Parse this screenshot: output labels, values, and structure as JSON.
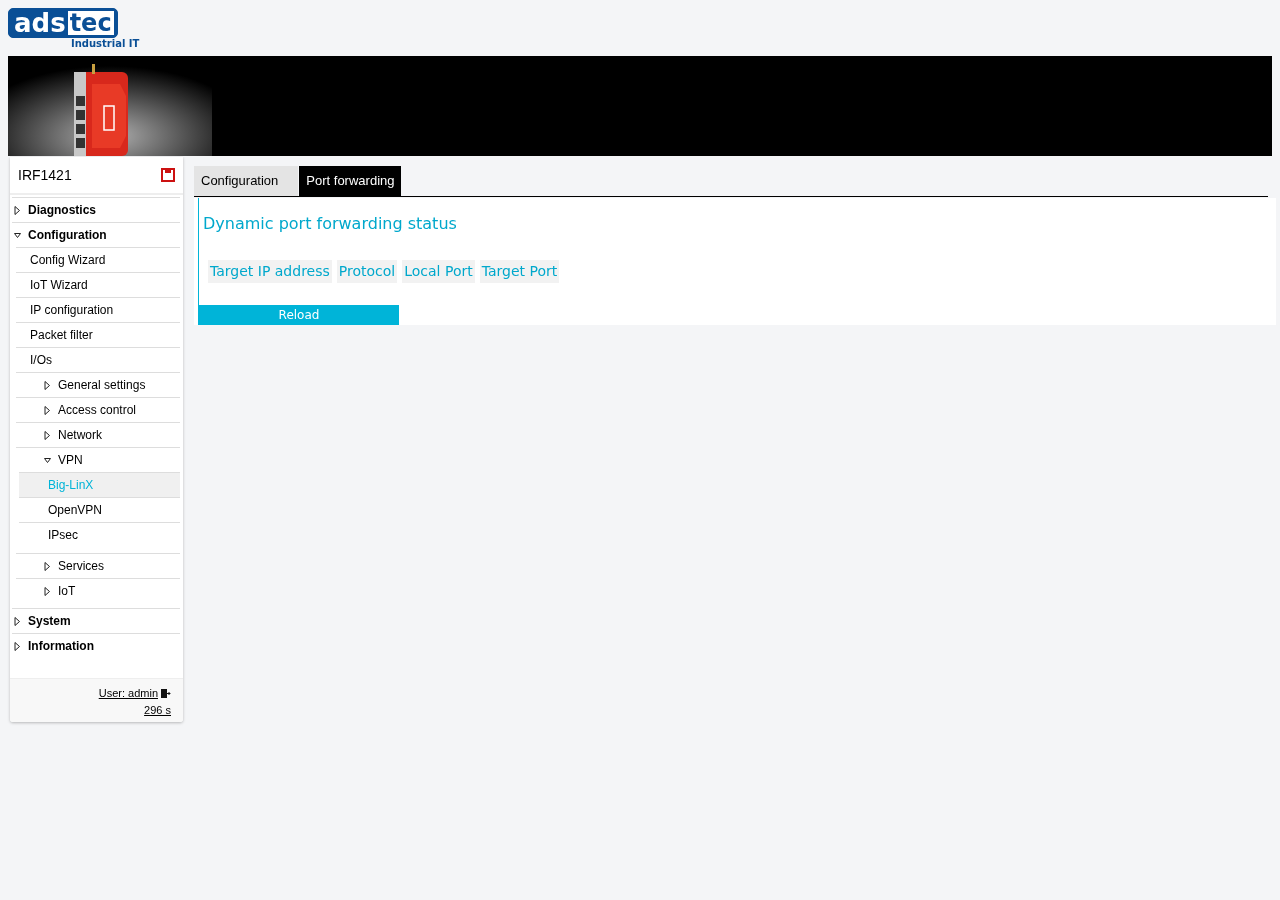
{
  "logo": {
    "left": "ads",
    "right": "tec",
    "tagline": "Industrial IT"
  },
  "sidebar": {
    "device": "IRF1421",
    "items": [
      {
        "label": "Diagnostics",
        "expanded": false
      },
      {
        "label": "Configuration",
        "expanded": true,
        "children": [
          {
            "label": "Config Wizard"
          },
          {
            "label": "IoT Wizard"
          },
          {
            "label": "IP configuration"
          },
          {
            "label": "Packet filter"
          },
          {
            "label": "I/Os"
          },
          {
            "label": "General settings",
            "expanded": false
          },
          {
            "label": "Access control",
            "expanded": false
          },
          {
            "label": "Network",
            "expanded": false
          },
          {
            "label": "VPN",
            "expanded": true,
            "children": [
              {
                "label": "Big-LinX",
                "selected": true
              },
              {
                "label": "OpenVPN",
                "selected": false
              },
              {
                "label": "IPsec",
                "selected": false
              }
            ]
          },
          {
            "label": "Services",
            "expanded": false
          },
          {
            "label": "IoT",
            "expanded": false
          }
        ]
      },
      {
        "label": "System",
        "expanded": false
      },
      {
        "label": "Information",
        "expanded": false
      }
    ],
    "user": "User: admin",
    "timer": "296 s"
  },
  "tabs": [
    {
      "label": "Configuration",
      "selected": false
    },
    {
      "label": "Port forwarding",
      "selected": true
    }
  ],
  "panel": {
    "title": "Dynamic port forwarding status",
    "columns": [
      "Target IP address",
      "Protocol",
      "Local Port",
      "Target Port"
    ],
    "button": "Reload"
  }
}
